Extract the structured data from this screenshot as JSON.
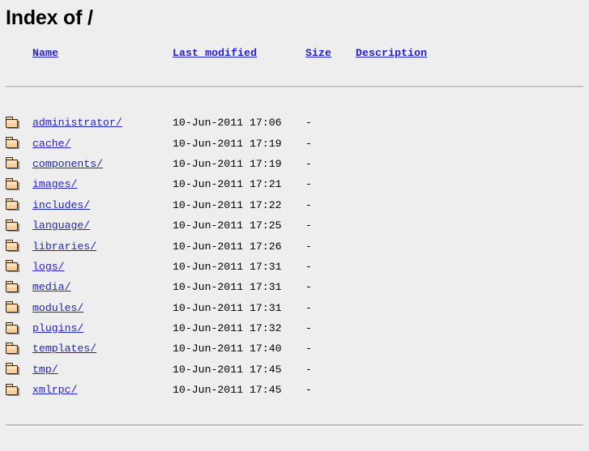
{
  "page": {
    "title": "Index of /"
  },
  "table": {
    "headers": {
      "icon": "",
      "name": "Name",
      "last_modified": "Last modified",
      "size": "Size",
      "description": "Description"
    },
    "rows": [
      {
        "icon": "folder-icon",
        "name": "administrator/",
        "last_modified": "10-Jun-2011 17:06",
        "size": "-",
        "description": ""
      },
      {
        "icon": "folder-icon",
        "name": "cache/",
        "last_modified": "10-Jun-2011 17:19",
        "size": "-",
        "description": ""
      },
      {
        "icon": "folder-icon",
        "name": "components/",
        "last_modified": "10-Jun-2011 17:19",
        "size": "-",
        "description": ""
      },
      {
        "icon": "folder-icon",
        "name": "images/",
        "last_modified": "10-Jun-2011 17:21",
        "size": "-",
        "description": ""
      },
      {
        "icon": "folder-icon",
        "name": "includes/",
        "last_modified": "10-Jun-2011 17:22",
        "size": "-",
        "description": ""
      },
      {
        "icon": "folder-icon",
        "name": "language/",
        "last_modified": "10-Jun-2011 17:25",
        "size": "-",
        "description": ""
      },
      {
        "icon": "folder-icon",
        "name": "libraries/",
        "last_modified": "10-Jun-2011 17:26",
        "size": "-",
        "description": ""
      },
      {
        "icon": "folder-icon",
        "name": "logs/",
        "last_modified": "10-Jun-2011 17:31",
        "size": "-",
        "description": ""
      },
      {
        "icon": "folder-icon",
        "name": "media/",
        "last_modified": "10-Jun-2011 17:31",
        "size": "-",
        "description": ""
      },
      {
        "icon": "folder-icon",
        "name": "modules/",
        "last_modified": "10-Jun-2011 17:31",
        "size": "-",
        "description": ""
      },
      {
        "icon": "folder-icon",
        "name": "plugins/",
        "last_modified": "10-Jun-2011 17:32",
        "size": "-",
        "description": ""
      },
      {
        "icon": "folder-icon",
        "name": "templates/",
        "last_modified": "10-Jun-2011 17:40",
        "size": "-",
        "description": ""
      },
      {
        "icon": "folder-icon",
        "name": "tmp/",
        "last_modified": "10-Jun-2011 17:45",
        "size": "-",
        "description": ""
      },
      {
        "icon": "folder-icon",
        "name": "xmlrpc/",
        "last_modified": "10-Jun-2011 17:45",
        "size": "-",
        "description": ""
      }
    ]
  },
  "colors": {
    "background": "#eeeeee",
    "link": "#2222cc",
    "text": "#000000",
    "rule": "#c0c0c0",
    "folder_fill": "#f7cf9c",
    "folder_outline": "#3b2b1b"
  }
}
